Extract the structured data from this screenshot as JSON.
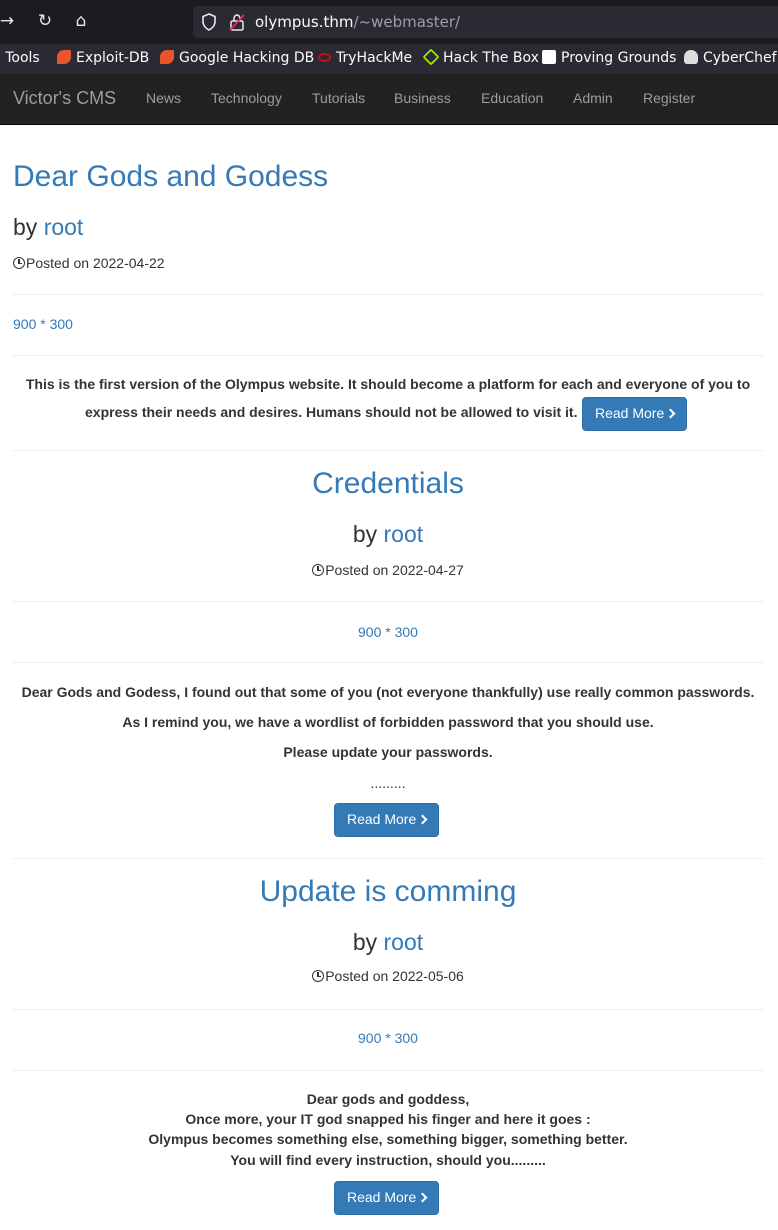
{
  "browser": {
    "url_host": "olympus.thm",
    "url_path": "/~webmaster/",
    "bookmarks": [
      {
        "label": "li Tools",
        "icon": "generic-icon",
        "color": "#2b2a33"
      },
      {
        "label": "Exploit-DB",
        "icon": "exploit-db-icon",
        "color": "#e8562a"
      },
      {
        "label": "Google Hacking DB",
        "icon": "ghdb-icon",
        "color": "#e8562a"
      },
      {
        "label": "TryHackMe",
        "icon": "tryhackme-icon",
        "color": "#c11111"
      },
      {
        "label": "Hack The Box",
        "icon": "hackthebox-icon",
        "color": "#9fef00"
      },
      {
        "label": "Proving Grounds",
        "icon": "proving-grounds-icon",
        "color": "#ffffff"
      },
      {
        "label": "CyberChef",
        "icon": "cyberchef-icon",
        "color": "#dddddd"
      }
    ]
  },
  "navbar": {
    "brand": "Victor's CMS",
    "links": [
      "News",
      "Technology",
      "Tutorials",
      "Business",
      "Education",
      "Admin",
      "Register"
    ]
  },
  "posts": [
    {
      "title": "Dear Gods and Godess",
      "by_prefix": "by",
      "author": "root",
      "posted": "Posted on 2022-04-22",
      "image_alt": "900 * 300",
      "body": [
        "This is the first version of the Olympus website. It should become a platform for each and everyone of you to",
        "express their needs and desires. Humans should not be allowed to visit it."
      ],
      "button": "Read More"
    },
    {
      "title": "Credentials",
      "by_prefix": "by",
      "author": "root",
      "posted": "Posted on 2022-04-27",
      "image_alt": "900 * 300",
      "body": [
        "Dear Gods and Godess, I found out that some of you (not everyone thankfully) use really common passwords.",
        "As I remind you, we have a wordlist of forbidden password that you should use.",
        "Please update your passwords.",
        "........."
      ],
      "button": "Read More"
    },
    {
      "title": "Update is comming",
      "by_prefix": "by",
      "author": "root",
      "posted": "Posted on 2022-05-06",
      "image_alt": "900 * 300",
      "body": [
        "Dear gods and goddess,",
        "Once more, your IT god snapped his finger and here it goes :",
        "Olympus becomes something else, something bigger, something better.",
        "You will find every instruction, should you........."
      ],
      "button": "Read More"
    }
  ]
}
